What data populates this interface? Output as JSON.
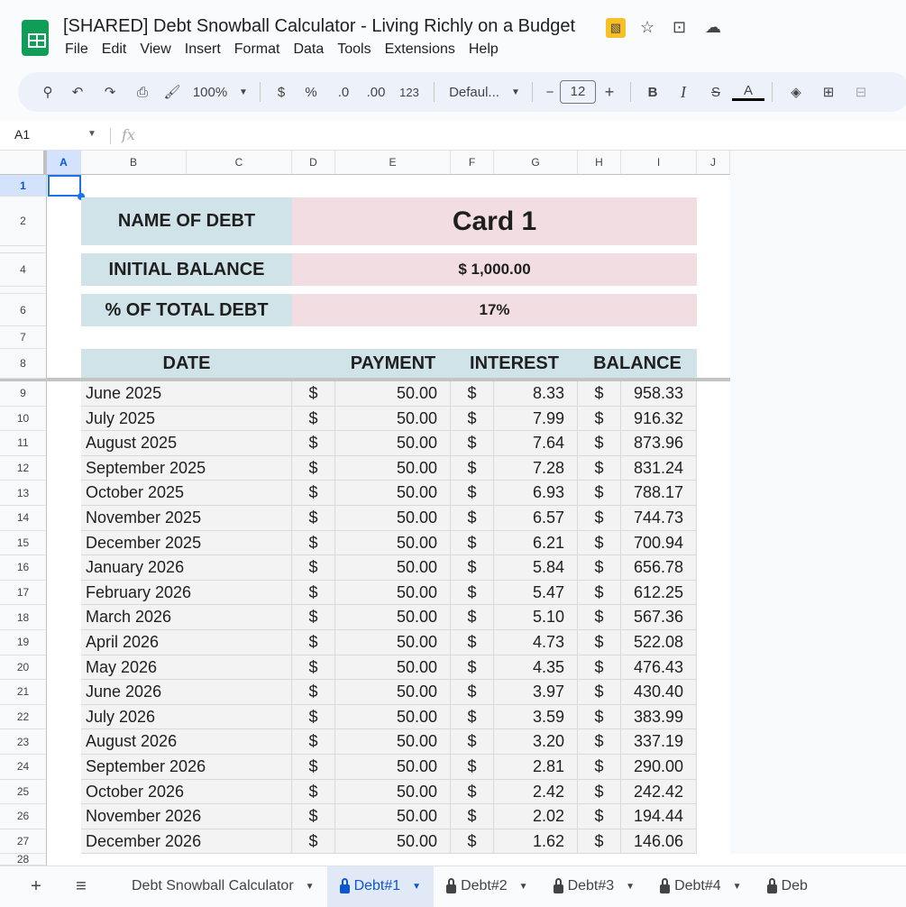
{
  "app": {
    "title": "[SHARED] Debt Snowball Calculator - Living Richly on a Budget",
    "menu": [
      "File",
      "Edit",
      "View",
      "Insert",
      "Format",
      "Data",
      "Tools",
      "Extensions",
      "Help"
    ]
  },
  "toolbar": {
    "zoom": "100%",
    "currency": "$",
    "percent": "%",
    "dec_decrease": ".0",
    "dec_increase": ".00",
    "number_format": "123",
    "font": "Defaul...",
    "font_size": "12",
    "bold": "B",
    "italic": "I",
    "text_color": "A"
  },
  "formula_bar": {
    "cell_ref": "A1",
    "fx": "fx",
    "value": ""
  },
  "columns": [
    "A",
    "B",
    "C",
    "D",
    "E",
    "F",
    "G",
    "H",
    "I",
    "J"
  ],
  "summary": {
    "name_label": "NAME OF DEBT",
    "name_value": "Card 1",
    "balance_label": "INITIAL BALANCE",
    "balance_value": "$ 1,000.00",
    "pct_label": "% OF TOTAL DEBT",
    "pct_value": "17%"
  },
  "table": {
    "headers": {
      "date": "DATE",
      "payment": "PAYMENT",
      "interest": "INTEREST",
      "balance": "BALANCE"
    },
    "currency_symbol": "$",
    "rows": [
      [
        "June 2025",
        "50.00",
        "8.33",
        "958.33"
      ],
      [
        "July 2025",
        "50.00",
        "7.99",
        "916.32"
      ],
      [
        "August 2025",
        "50.00",
        "7.64",
        "873.96"
      ],
      [
        "September 2025",
        "50.00",
        "7.28",
        "831.24"
      ],
      [
        "October 2025",
        "50.00",
        "6.93",
        "788.17"
      ],
      [
        "November 2025",
        "50.00",
        "6.57",
        "744.73"
      ],
      [
        "December 2025",
        "50.00",
        "6.21",
        "700.94"
      ],
      [
        "January 2026",
        "50.00",
        "5.84",
        "656.78"
      ],
      [
        "February 2026",
        "50.00",
        "5.47",
        "612.25"
      ],
      [
        "March 2026",
        "50.00",
        "5.10",
        "567.36"
      ],
      [
        "April 2026",
        "50.00",
        "4.73",
        "522.08"
      ],
      [
        "May 2026",
        "50.00",
        "4.35",
        "476.43"
      ],
      [
        "June 2026",
        "50.00",
        "3.97",
        "430.40"
      ],
      [
        "July 2026",
        "50.00",
        "3.59",
        "383.99"
      ],
      [
        "August 2026",
        "50.00",
        "3.20",
        "337.19"
      ],
      [
        "September 2026",
        "50.00",
        "2.81",
        "290.00"
      ],
      [
        "October 2026",
        "50.00",
        "2.42",
        "242.42"
      ],
      [
        "November 2026",
        "50.00",
        "2.02",
        "194.44"
      ],
      [
        "December 2026",
        "50.00",
        "1.62",
        "146.06"
      ]
    ]
  },
  "sheet_tabs": {
    "add": "+",
    "list": "≡",
    "tabs": [
      {
        "label": "Debt Snowball Calculator",
        "locked": false,
        "active": false
      },
      {
        "label": "Debt#1",
        "locked": true,
        "active": true
      },
      {
        "label": "Debt#2",
        "locked": true,
        "active": false
      },
      {
        "label": "Debt#3",
        "locked": true,
        "active": false
      },
      {
        "label": "Debt#4",
        "locked": true,
        "active": false
      },
      {
        "label": "Deb",
        "locked": true,
        "active": false
      }
    ]
  },
  "colors": {
    "header_blue": "#d0e3e9",
    "value_pink": "#f2dde3",
    "accent": "#0b57d0"
  }
}
